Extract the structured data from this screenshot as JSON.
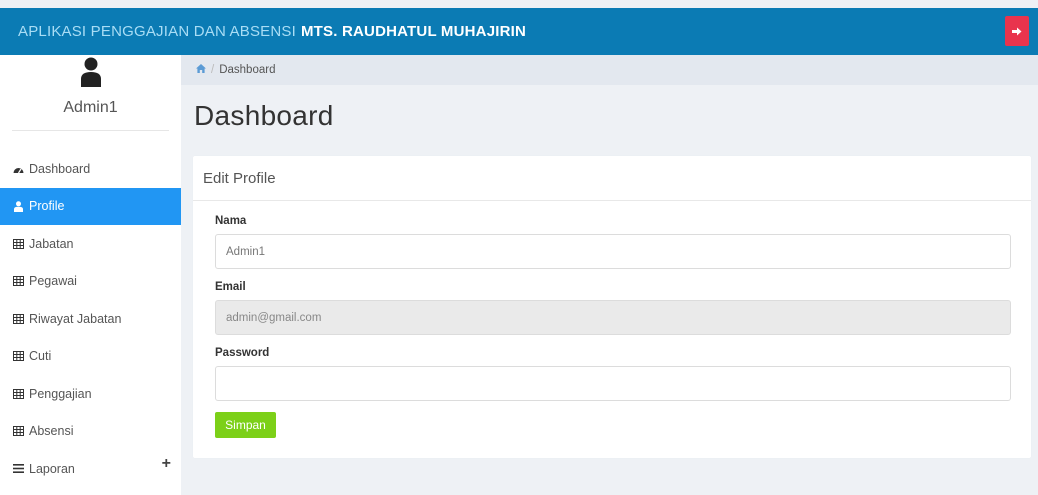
{
  "header": {
    "title_prefix": "APLIKASI PENGGAJIAN DAN ABSENSI",
    "title_school": "MTS. RAUDHATUL MUHAJIRIN",
    "logout_icon": "sign-out-icon"
  },
  "sidebar": {
    "user_name": "Admin1",
    "avatar_icon": "user-icon",
    "items": [
      {
        "label": "Dashboard",
        "icon": "dashboard-icon",
        "active": false
      },
      {
        "label": "Profile",
        "icon": "user-icon",
        "active": true
      },
      {
        "label": "Jabatan",
        "icon": "table-icon",
        "active": false
      },
      {
        "label": "Pegawai",
        "icon": "table-icon",
        "active": false
      },
      {
        "label": "Riwayat Jabatan",
        "icon": "table-icon",
        "active": false
      },
      {
        "label": "Cuti",
        "icon": "table-icon",
        "active": false
      },
      {
        "label": "Penggajian",
        "icon": "table-icon",
        "active": false
      },
      {
        "label": "Absensi",
        "icon": "table-icon",
        "active": false
      },
      {
        "label": "Laporan",
        "icon": "bars-icon",
        "active": false,
        "expand": "+"
      }
    ]
  },
  "breadcrumb": {
    "home_icon": "home-icon",
    "separator": "/",
    "current": "Dashboard"
  },
  "main": {
    "page_title": "Dashboard",
    "card_title": "Edit Profile",
    "form": {
      "nama_label": "Nama",
      "nama_value": "Admin1",
      "email_label": "Email",
      "email_value": "admin@gmail.com",
      "password_label": "Password",
      "password_value": "",
      "save_label": "Simpan"
    }
  },
  "colors": {
    "topbar": "#0b7bb4",
    "active_menu": "#2196f3",
    "logout": "#e9344d",
    "save_button": "#7cd018"
  }
}
